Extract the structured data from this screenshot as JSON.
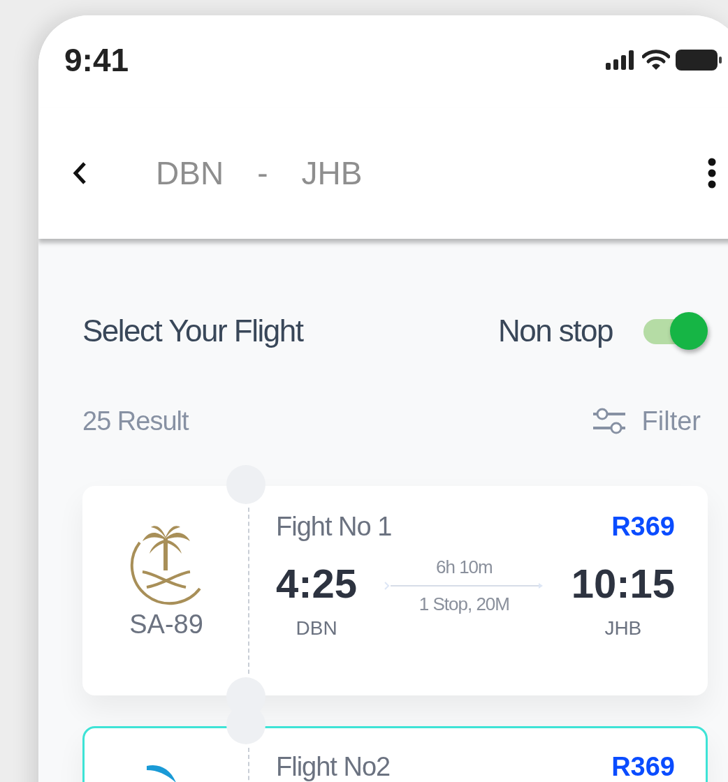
{
  "status_bar": {
    "time": "9:41"
  },
  "header": {
    "origin": "DBN",
    "separator": "-",
    "destination": "JHB"
  },
  "title": "Select Your Flight",
  "non_stop": {
    "label": "Non stop",
    "on": true
  },
  "results": {
    "count": "25 Result",
    "filter": "Filter"
  },
  "flights": [
    {
      "selected": false,
      "kind": "palm",
      "code": "SA-89",
      "name": "Fight No 1",
      "price": "R369",
      "depart_time": "4:25",
      "depart_airport": "DBN",
      "duration": "6h 10m",
      "stops": "1 Stop, 20M",
      "arrive_time": "10:15",
      "arrive_airport": "JHB"
    },
    {
      "selected": true,
      "kind": "wing",
      "name": "Flight No2",
      "price": "R369"
    }
  ]
}
